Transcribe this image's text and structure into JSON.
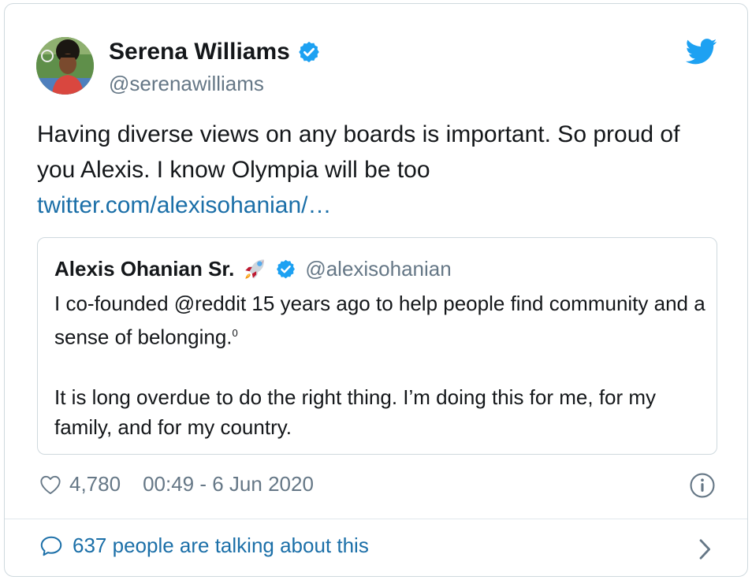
{
  "tweet": {
    "author": {
      "name": "Serena Williams",
      "handle": "@serenawilliams",
      "verified_icon": "verified-badge-icon",
      "avatar_icon": "avatar-image"
    },
    "brand_icon": "twitter-bird-icon",
    "text": "Having diverse views on any boards is important. So proud of you Alexis. I know Olympia will be too",
    "link": "twitter.com/alexisohanian/…",
    "quoted": {
      "name": "Alexis Ohanian Sr.",
      "emoji_icon": "rocket-icon",
      "verified_icon": "verified-badge-icon",
      "handle": "@alexisohanian",
      "paragraph1": "I co-founded @reddit 15 years ago to help people find community and a sense of belonging.",
      "paragraph1_sup": "0",
      "paragraph2": "It is long overdue to do the right thing. I’m doing this for me, for my family, and for my country."
    },
    "likes": "4,780",
    "timestamp": "00:49 - 6 Jun 2020",
    "talking": "637 people are talking about this"
  },
  "colors": {
    "link": "#1b6fa8",
    "verified": "#1da1f2",
    "twitter_brand": "#1da1f2",
    "muted": "#657786",
    "border": "#cfd9de"
  }
}
